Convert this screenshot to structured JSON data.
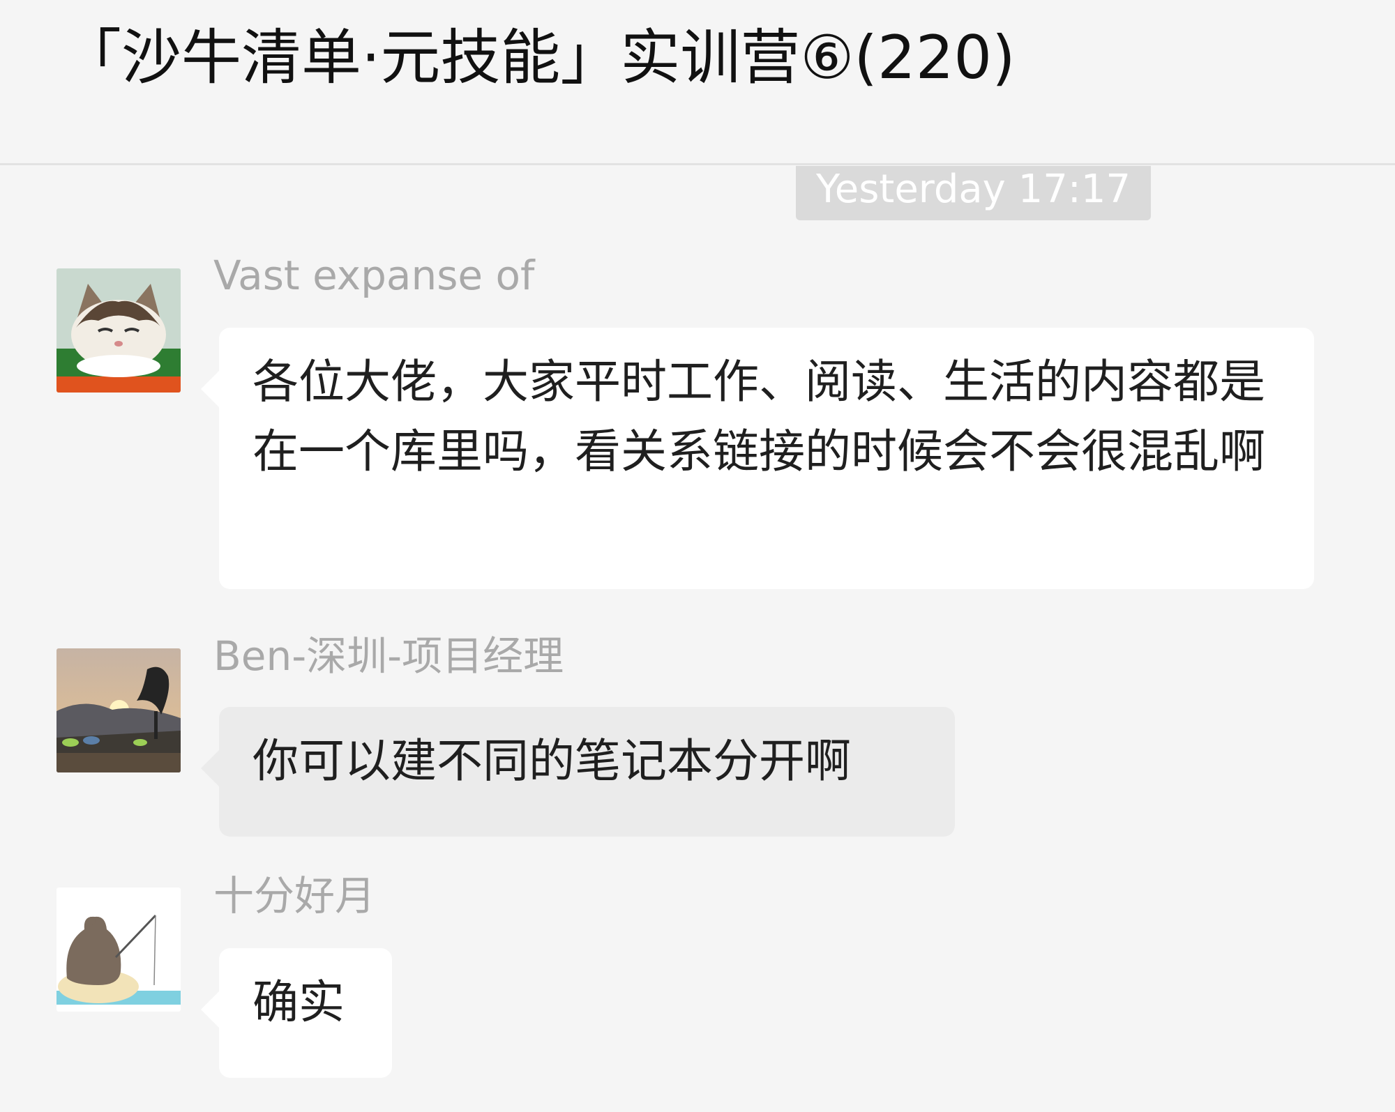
{
  "chat": {
    "title": "「沙牛清单·元技能」实训营⑥(220)"
  },
  "timestamp": "Yesterday 17:17",
  "messages": [
    {
      "sender": "Vast expanse of",
      "avatar_icon": "cat-avatar-icon",
      "text": "各位大佬，大家平时工作、阅读、生活的内容都是在一个库里吗，看关系链接的时候会不会很混乱啊",
      "bubble_color": "#ffffff"
    },
    {
      "sender": "Ben-深圳-项目经理",
      "avatar_icon": "sunset-avatar-icon",
      "text": "你可以建不同的笔记本分开啊",
      "bubble_color": "#ebebeb"
    },
    {
      "sender": "十分好月",
      "avatar_icon": "fishing-bear-avatar-icon",
      "text": "确实",
      "bubble_color": "#ffffff"
    }
  ]
}
